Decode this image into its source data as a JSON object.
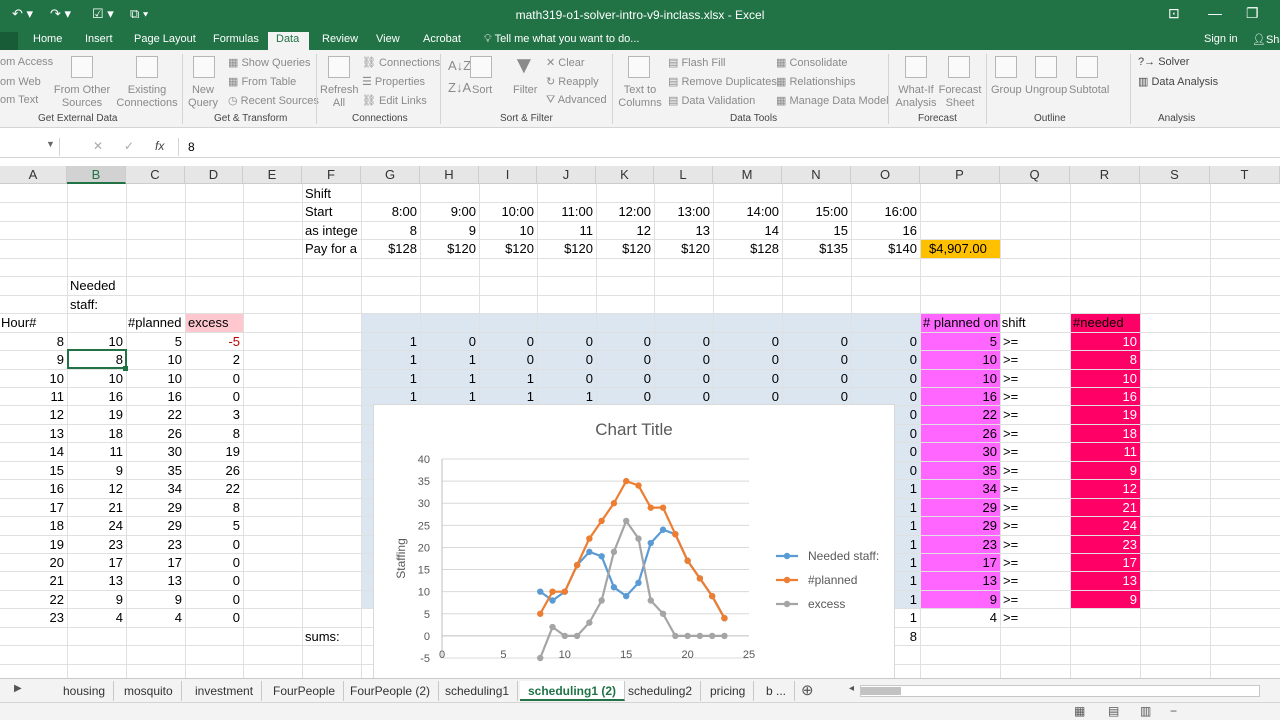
{
  "window": {
    "title": "math319-o1-solver-intro-v9-inclass.xlsx - Excel",
    "signin": "Sign in",
    "share": "Sha"
  },
  "ribbon_tabs": [
    "Home",
    "Insert",
    "Page Layout",
    "Formulas",
    "Data",
    "Review",
    "View",
    "Acrobat"
  ],
  "tell_me": "Tell me what you want to do...",
  "ribbon": {
    "get_external": {
      "items": [
        "om Access",
        "om Web",
        "om Text",
        "From Other Sources",
        "Existing Connections"
      ],
      "label": "Get External Data"
    },
    "transform": {
      "new_query": "New Query",
      "items": [
        "Show Queries",
        "From Table",
        "Recent Sources"
      ],
      "label": "Get & Transform"
    },
    "connections": {
      "refresh": "Refresh All",
      "items": [
        "Connections",
        "Properties",
        "Edit Links"
      ],
      "label": "Connections"
    },
    "sort_filter": {
      "sort": "Sort",
      "filter": "Filter",
      "items": [
        "Clear",
        "Reapply",
        "Advanced"
      ],
      "label": "Sort & Filter"
    },
    "data_tools": {
      "t2c": "Text to Columns",
      "items": [
        "Flash Fill",
        "Remove Duplicates",
        "Data Validation",
        "Consolidate",
        "Relationships",
        "Manage Data Model"
      ],
      "label": "Data Tools"
    },
    "forecast": {
      "whatif": "What-If Analysis",
      "sheet": "Forecast Sheet",
      "label": "Forecast"
    },
    "outline": {
      "items": [
        "Group",
        "Ungroup",
        "Subtotal"
      ],
      "label": "Outline"
    },
    "analysis": {
      "items": [
        "Solver",
        "Data Analysis"
      ],
      "label": "Analysis"
    }
  },
  "formula_bar": {
    "value": "8",
    "fx": "fx"
  },
  "columns": [
    "A",
    "B",
    "C",
    "D",
    "E",
    "F",
    "G",
    "H",
    "I",
    "J",
    "K",
    "L",
    "M",
    "N",
    "O",
    "P",
    "Q",
    "R",
    "S",
    "T"
  ],
  "header_rows": {
    "shift": "Shift",
    "start": "Start",
    "as_integer": "as intege",
    "pay": "Pay for a",
    "start_times": [
      "8:00",
      "9:00",
      "10:00",
      "11:00",
      "12:00",
      "13:00",
      "14:00",
      "15:00",
      "16:00"
    ],
    "integers": [
      "8",
      "9",
      "10",
      "11",
      "12",
      "13",
      "14",
      "15",
      "16"
    ],
    "pays": [
      "$128",
      "$120",
      "$120",
      "$120",
      "$120",
      "$120",
      "$128",
      "$135",
      "$140"
    ],
    "total": "$4,907.00"
  },
  "labels": {
    "needed1": "Needed",
    "needed2": "staff:",
    "hour": "Hour#",
    "planned": "#planned",
    "excess": "excess",
    "planned_on_shift": "# planned on shift",
    "needed_r": "#needed",
    "sums": "sums:",
    "ge": ">="
  },
  "rows": [
    {
      "h": "8",
      "n": "10",
      "p": "5",
      "e": "-5",
      "m": [
        "1",
        "0",
        "0",
        "0",
        "0",
        "0",
        "0",
        "0",
        "0"
      ],
      "ps": "5",
      "nr": "10"
    },
    {
      "h": "9",
      "n": "8",
      "p": "10",
      "e": "2",
      "m": [
        "1",
        "1",
        "0",
        "0",
        "0",
        "0",
        "0",
        "0",
        "0"
      ],
      "ps": "10",
      "nr": "8"
    },
    {
      "h": "10",
      "n": "10",
      "p": "10",
      "e": "0",
      "m": [
        "1",
        "1",
        "1",
        "0",
        "0",
        "0",
        "0",
        "0",
        "0"
      ],
      "ps": "10",
      "nr": "10"
    },
    {
      "h": "11",
      "n": "16",
      "p": "16",
      "e": "0",
      "m": [
        "1",
        "1",
        "1",
        "1",
        "0",
        "0",
        "0",
        "0",
        "0"
      ],
      "ps": "16",
      "nr": "16"
    },
    {
      "h": "12",
      "n": "19",
      "p": "22",
      "e": "3",
      "m": [
        "1",
        "1",
        "1",
        "1",
        "1",
        "0",
        "0",
        "0",
        "0"
      ],
      "ps": "22",
      "nr": "19"
    },
    {
      "h": "13",
      "n": "18",
      "p": "26",
      "e": "8",
      "m": [
        "",
        "",
        "",
        "",
        "",
        "",
        "",
        "",
        "0"
      ],
      "ps": "26",
      "nr": "18"
    },
    {
      "h": "14",
      "n": "11",
      "p": "30",
      "e": "19",
      "m": [
        "",
        "",
        "",
        "",
        "",
        "",
        "",
        "",
        "0"
      ],
      "ps": "30",
      "nr": "11"
    },
    {
      "h": "15",
      "n": "9",
      "p": "35",
      "e": "26",
      "m": [
        "",
        "",
        "",
        "",
        "",
        "",
        "",
        "",
        "0"
      ],
      "ps": "35",
      "nr": "9"
    },
    {
      "h": "16",
      "n": "12",
      "p": "34",
      "e": "22",
      "m": [
        "",
        "",
        "",
        "",
        "",
        "",
        "",
        "",
        "1"
      ],
      "ps": "34",
      "nr": "12"
    },
    {
      "h": "17",
      "n": "21",
      "p": "29",
      "e": "8",
      "m": [
        "",
        "",
        "",
        "",
        "",
        "",
        "",
        "",
        "1"
      ],
      "ps": "29",
      "nr": "21"
    },
    {
      "h": "18",
      "n": "24",
      "p": "29",
      "e": "5",
      "m": [
        "",
        "",
        "",
        "",
        "",
        "",
        "",
        "",
        "1"
      ],
      "ps": "29",
      "nr": "24"
    },
    {
      "h": "19",
      "n": "23",
      "p": "23",
      "e": "0",
      "m": [
        "",
        "",
        "",
        "",
        "",
        "",
        "",
        "",
        "1"
      ],
      "ps": "23",
      "nr": "23"
    },
    {
      "h": "20",
      "n": "17",
      "p": "17",
      "e": "0",
      "m": [
        "",
        "",
        "",
        "",
        "",
        "",
        "",
        "",
        "1"
      ],
      "ps": "17",
      "nr": "17"
    },
    {
      "h": "21",
      "n": "13",
      "p": "13",
      "e": "0",
      "m": [
        "",
        "",
        "",
        "",
        "",
        "",
        "",
        "",
        "1"
      ],
      "ps": "13",
      "nr": "13"
    },
    {
      "h": "22",
      "n": "9",
      "p": "9",
      "e": "0",
      "m": [
        "",
        "",
        "",
        "",
        "",
        "",
        "",
        "",
        "1"
      ],
      "ps": "9",
      "nr": "9"
    },
    {
      "h": "23",
      "n": "4",
      "p": "4",
      "e": "0",
      "m": [
        "",
        "",
        "",
        "",
        "",
        "",
        "",
        "",
        "1"
      ],
      "ps": "4",
      "nr": "4"
    }
  ],
  "sum_o": "8",
  "chart_data": {
    "type": "line",
    "title": "Chart Title",
    "xlabel": "",
    "ylabel": "Staffing",
    "xlim": [
      0,
      25
    ],
    "ylim": [
      -5,
      40
    ],
    "xticks": [
      0,
      5,
      10,
      15,
      20,
      25
    ],
    "yticks": [
      -5,
      0,
      5,
      10,
      15,
      20,
      25,
      30,
      35,
      40
    ],
    "x": [
      8,
      9,
      10,
      11,
      12,
      13,
      14,
      15,
      16,
      17,
      18,
      19,
      20,
      21,
      22,
      23
    ],
    "series": [
      {
        "name": "Needed staff:",
        "color": "#5b9bd5",
        "values": [
          10,
          8,
          10,
          16,
          19,
          18,
          11,
          9,
          12,
          21,
          24,
          23,
          17,
          13,
          9,
          4
        ]
      },
      {
        "name": "#planned",
        "color": "#ed7d31",
        "values": [
          5,
          10,
          10,
          16,
          22,
          26,
          30,
          35,
          34,
          29,
          29,
          23,
          17,
          13,
          9,
          4
        ]
      },
      {
        "name": "excess",
        "color": "#a5a5a5",
        "values": [
          -5,
          2,
          0,
          0,
          3,
          8,
          19,
          26,
          22,
          8,
          5,
          0,
          0,
          0,
          0,
          0
        ]
      }
    ],
    "legend": "right",
    "grid": true
  },
  "sheet_tabs": [
    "housing",
    "mosquito",
    "investment",
    "FourPeople",
    "FourPeople (2)",
    "scheduling1",
    "scheduling1 (2)",
    "scheduling2",
    "pricing",
    "b ..."
  ],
  "active_sheet": "scheduling1 (2)",
  "colors": {
    "accent": "#217346",
    "pink": "#ff66ff",
    "red": "#ff0066",
    "blue_fill": "#dce6f1",
    "orange": "#ffc000",
    "neg": "#ffc7ce"
  }
}
